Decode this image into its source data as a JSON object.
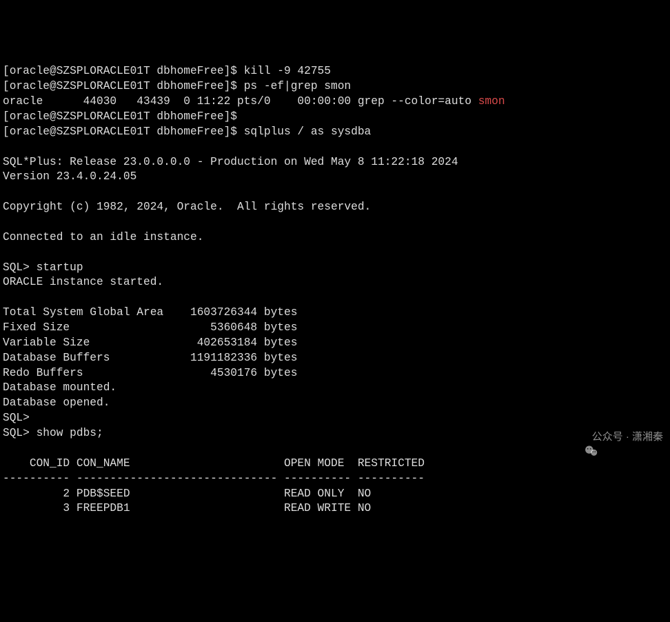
{
  "prompt": {
    "user": "oracle",
    "host": "SZSPLORACLE01T",
    "dir": "dbhomeFree"
  },
  "cmds": {
    "kill": "kill -9 42755",
    "ps": "ps -ef|grep smon",
    "sqlplus": "sqlplus / as sysdba"
  },
  "ps_output": {
    "user": "oracle",
    "pid": "44030",
    "ppid": "43439",
    "c": "0",
    "stime": "11:22",
    "tty": "pts/0",
    "time": "00:00:00",
    "cmd_prefix": "grep --color=auto ",
    "cmd_match": "smon"
  },
  "sqlplus": {
    "banner1": "SQL*Plus: Release 23.0.0.0.0 - Production on Wed May 8 11:22:18 2024",
    "banner2": "Version 23.4.0.24.05",
    "copyright": "Copyright (c) 1982, 2024, Oracle.  All rights reserved.",
    "connected": "Connected to an idle instance.",
    "prompt": "SQL>",
    "startup_cmd": "startup",
    "started": "ORACLE instance started.",
    "showpdbs_cmd": "show pdbs;",
    "sga": {
      "total": {
        "label": "Total System Global Area",
        "value": "1603726344",
        "unit": "bytes"
      },
      "fixed": {
        "label": "Fixed Size",
        "value": "5360648",
        "unit": "bytes"
      },
      "var": {
        "label": "Variable Size",
        "value": "402653184",
        "unit": "bytes"
      },
      "dbbuf": {
        "label": "Database Buffers",
        "value": "1191182336",
        "unit": "bytes"
      },
      "redo": {
        "label": "Redo Buffers",
        "value": "4530176",
        "unit": "bytes"
      }
    },
    "mounted": "Database mounted.",
    "opened": "Database opened.",
    "pdbs_header": {
      "con_id": "CON_ID",
      "con_name": "CON_NAME",
      "open_mode": "OPEN MODE",
      "restricted": "RESTRICTED"
    },
    "pdbs_divider": "---------- ------------------------------ ---------- ----------",
    "pdbs_rows": [
      {
        "con_id": "2",
        "con_name": "PDB$SEED",
        "open_mode": "READ ONLY",
        "restricted": "NO"
      },
      {
        "con_id": "3",
        "con_name": "FREEPDB1",
        "open_mode": "READ WRITE",
        "restricted": "NO"
      }
    ]
  },
  "watermark": {
    "text": "公众号 · 潇湘秦"
  }
}
